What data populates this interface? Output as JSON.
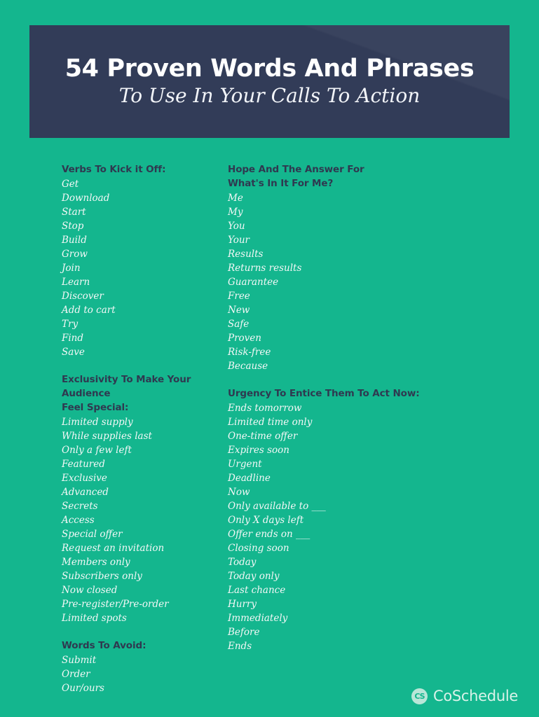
{
  "colors": {
    "background_teal": "#14b68e",
    "header_navy": "#323c58",
    "heading_navy": "#2f3950",
    "list_text": "#f4f8f7",
    "logo_text": "#d9f2e9"
  },
  "header": {
    "title": "54 Proven Words And Phrases",
    "subtitle": "To Use In Your Calls To Action"
  },
  "columns": {
    "left": [
      {
        "heading": "Verbs To Kick it Off:",
        "items": [
          "Get",
          "Download",
          "Start",
          "Stop",
          "Build",
          "Grow",
          "Join",
          "Learn",
          "Discover",
          "Add to cart",
          "Try",
          "Find",
          "Save"
        ]
      },
      {
        "heading": "Exclusivity To Make Your Audience\nFeel Special:",
        "items": [
          "Limited supply",
          "While supplies last",
          "Only a few left",
          "Featured",
          "Exclusive",
          "Advanced",
          "Secrets",
          "Access",
          "Special offer",
          "Request an invitation",
          "Members only",
          "Subscribers only",
          "Now closed",
          "Pre-register/Pre-order",
          "Limited spots"
        ]
      },
      {
        "heading": "Words To Avoid:",
        "items": [
          "Submit",
          "Order",
          "Our/ours"
        ]
      }
    ],
    "right": [
      {
        "heading": "Hope And The Answer For\nWhat's In It For Me?",
        "items": [
          "Me",
          "My",
          "You",
          "Your",
          "Results",
          "Returns results",
          "Guarantee",
          "Free",
          "New",
          "Safe",
          "Proven",
          "Risk-free",
          "Because"
        ]
      },
      {
        "heading": "Urgency To Entice Them To Act Now:",
        "items": [
          "Ends tomorrow",
          "Limited time only",
          "One-time offer",
          "Expires soon",
          "Urgent",
          "Deadline",
          "Now",
          "Only available to ___",
          "Only X days left",
          "Offer ends on ___",
          "Closing soon",
          "Today",
          "Today only",
          "Last chance",
          "Hurry",
          "Immediately",
          "Before",
          "Ends"
        ]
      }
    ]
  },
  "footer": {
    "logo_monogram": "CS",
    "logo_icon": "coschedule-circle-icon",
    "brand": "CoSchedule"
  }
}
